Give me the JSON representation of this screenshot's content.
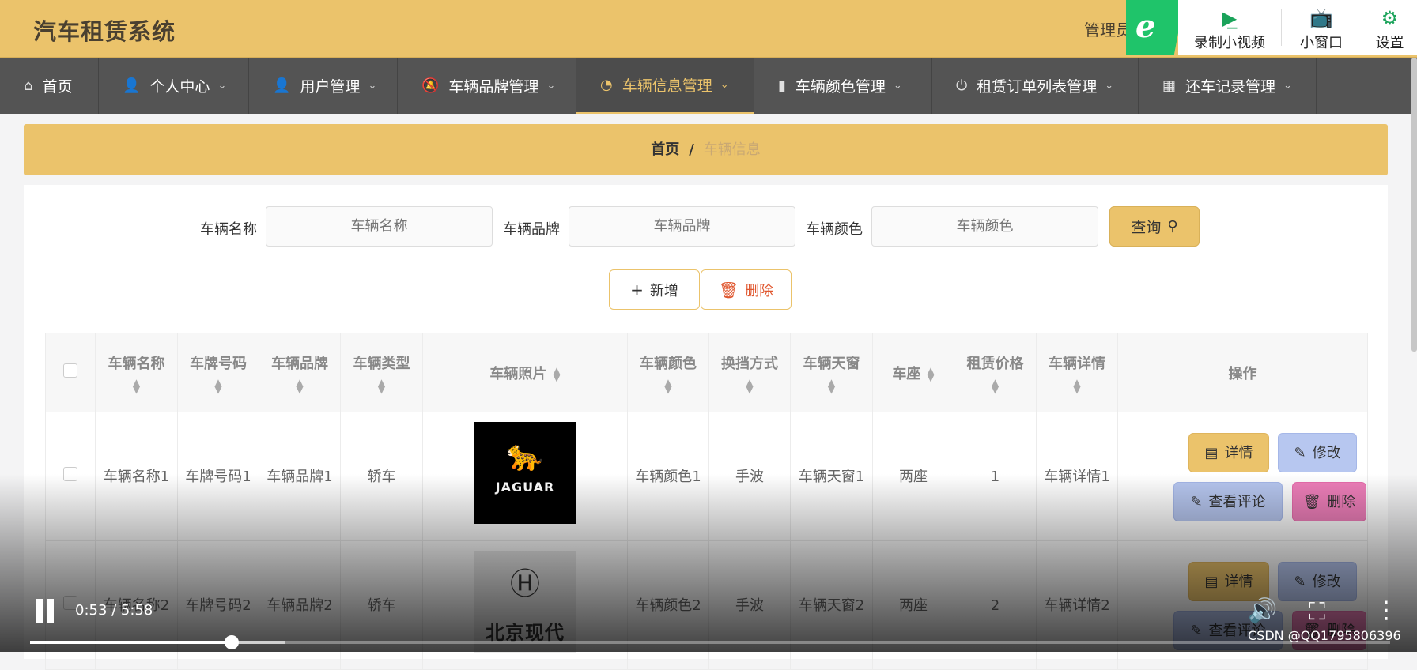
{
  "header": {
    "app_title": "汽车租赁系统",
    "admin_label": "管理员",
    "extension": {
      "logo_letter": "e",
      "record_video_label": "录制小视频",
      "mini_window_label": "小窗口",
      "settings_label": "设置"
    }
  },
  "nav": {
    "items": [
      {
        "label": "首页",
        "icon": "home-icon"
      },
      {
        "label": "个人中心",
        "icon": "user-icon"
      },
      {
        "label": "用户管理",
        "icon": "user-icon"
      },
      {
        "label": "车辆品牌管理",
        "icon": "bell-off-icon"
      },
      {
        "label": "车辆信息管理",
        "icon": "dashboard-icon",
        "active": true
      },
      {
        "label": "车辆颜色管理",
        "icon": "bar-chart-icon"
      },
      {
        "label": "租赁订单列表管理",
        "icon": "power-icon"
      },
      {
        "label": "还车记录管理",
        "icon": "grid-icon"
      }
    ]
  },
  "breadcrumb": {
    "home": "首页",
    "separator": "/",
    "current": "车辆信息"
  },
  "search": {
    "name_label": "车辆名称",
    "name_placeholder": "车辆名称",
    "brand_label": "车辆品牌",
    "brand_placeholder": "车辆品牌",
    "color_label": "车辆颜色",
    "color_placeholder": "车辆颜色",
    "query_label": "查询"
  },
  "actions": {
    "add_label": "新增",
    "delete_label": "删除"
  },
  "table": {
    "columns": [
      "车辆名称",
      "车牌号码",
      "车辆品牌",
      "车辆类型",
      "车辆照片",
      "车辆颜色",
      "换挡方式",
      "车辆天窗",
      "车座",
      "租赁价格",
      "车辆详情",
      "操作"
    ],
    "rows": [
      {
        "name": "车辆名称1",
        "plate": "车牌号码1",
        "brand": "车辆品牌1",
        "type": "轿车",
        "photo_text": "JAGUAR",
        "color": "车辆颜色1",
        "gear": "手波",
        "sunroof": "车辆天窗1",
        "seats": "两座",
        "price": "1",
        "detail": "车辆详情1"
      },
      {
        "name": "车辆名称2",
        "plate": "车牌号码2",
        "brand": "车辆品牌2",
        "type": "轿车",
        "photo_text": "北京现代",
        "color": "车辆颜色2",
        "gear": "手波",
        "sunroof": "车辆天窗2",
        "seats": "两座",
        "price": "2",
        "detail": "车辆详情2"
      }
    ],
    "op_labels": {
      "detail": "详情",
      "edit": "修改",
      "review": "查看评论",
      "delete": "删除"
    }
  },
  "video": {
    "time": "0:53 / 5:58",
    "progress": 0.148,
    "buffered": 0.188
  },
  "watermark": "CSDN @QQ1795806396",
  "colors": {
    "accent": "#ebc36b",
    "nav_bg": "#545454",
    "edit_blue": "#b7c7f0",
    "delete_pink": "#ef7fba",
    "danger_text": "#e0572f"
  }
}
